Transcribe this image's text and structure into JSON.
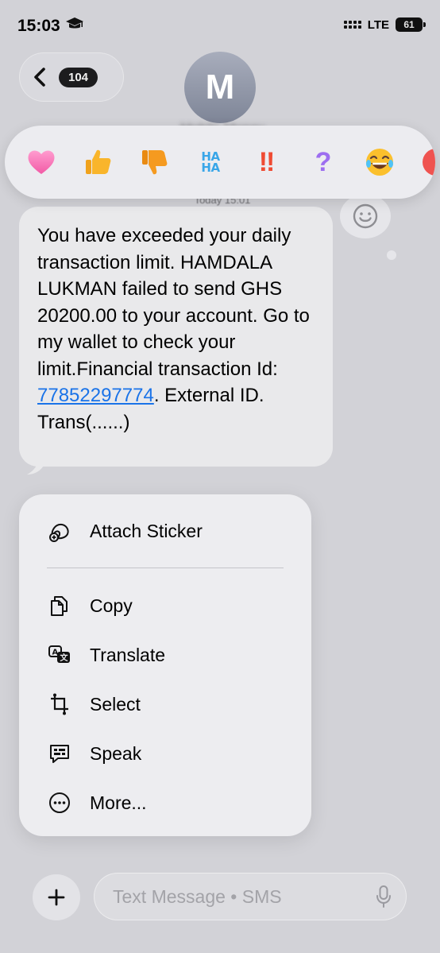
{
  "status_bar": {
    "time": "15:03",
    "network": "LTE",
    "battery": "61"
  },
  "header": {
    "unread_count": "104",
    "avatar_initial": "M",
    "contact_name": "Mobile Money",
    "date_label": "Today 15:01"
  },
  "reactions": [
    {
      "name": "heart",
      "glyph": "❤"
    },
    {
      "name": "thumbs-up",
      "glyph": "👍"
    },
    {
      "name": "thumbs-down",
      "glyph": "👎"
    },
    {
      "name": "haha",
      "glyph": "HA HA"
    },
    {
      "name": "exclamation",
      "glyph": "‼"
    },
    {
      "name": "question",
      "glyph": "?"
    },
    {
      "name": "laughing",
      "glyph": "😂"
    }
  ],
  "message": {
    "text_before_link": "You have exceeded your daily transaction limit. HAMDALA LUKMAN failed to send GHS 20200.00 to your account. Go to my wallet to check your limit.Financial transaction Id: ",
    "link": "77852297774",
    "text_after_link": ". External ID. Trans(......)"
  },
  "context_menu": {
    "attach_sticker": "Attach Sticker",
    "copy": "Copy",
    "translate": "Translate",
    "select": "Select",
    "speak": "Speak",
    "more": "More..."
  },
  "composer": {
    "placeholder": "Text Message • SMS"
  },
  "colors": {
    "background": "#d2d2d7",
    "bubble": "#e9e9eb",
    "link": "#1a73e8",
    "menu": "#ededf0"
  }
}
